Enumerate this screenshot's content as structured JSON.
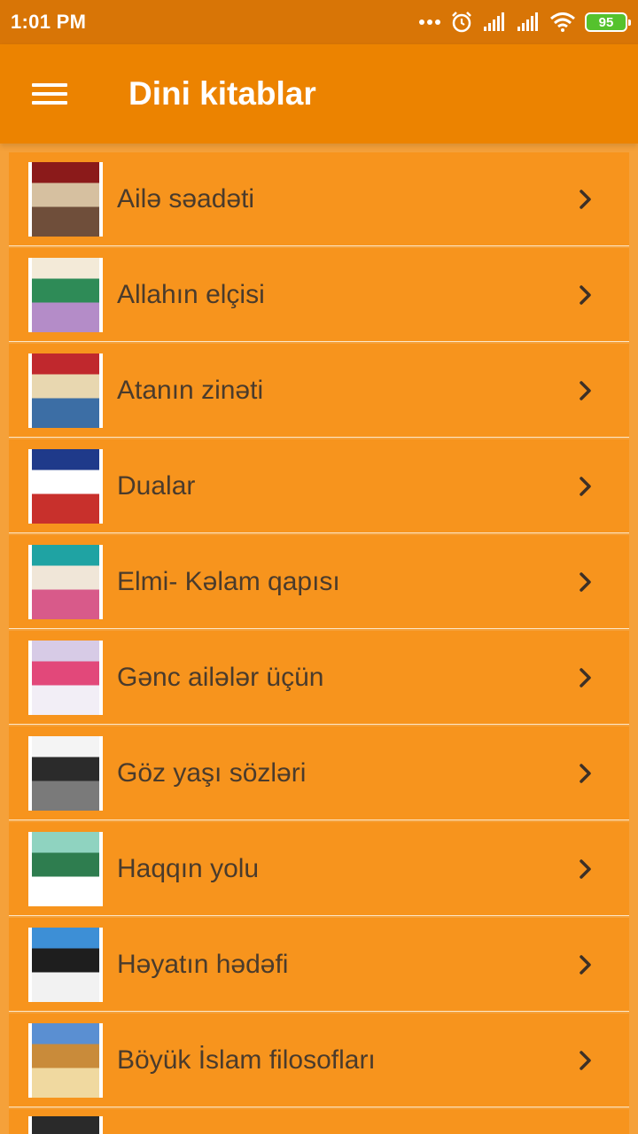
{
  "status_bar": {
    "time": "1:01 PM",
    "battery": "95"
  },
  "app_bar": {
    "title": "Dini kitablar",
    "menu_icon": "hamburger-menu-icon"
  },
  "books": [
    {
      "title": "Ailə səadəti",
      "cover_colors": [
        "#8b1a1a",
        "#d6c0a0",
        "#6f4e3a"
      ]
    },
    {
      "title": "Allahın elçisi",
      "cover_colors": [
        "#f3ead8",
        "#2e8b57",
        "#b48cc8"
      ]
    },
    {
      "title": "Atanın zinəti",
      "cover_colors": [
        "#c0282d",
        "#e8d7b0",
        "#3c6ea5"
      ]
    },
    {
      "title": "Dualar",
      "cover_colors": [
        "#1f3a8a",
        "#ffffff",
        "#c8302c"
      ]
    },
    {
      "title": "Elmi- Kəlam qapısı",
      "cover_colors": [
        "#1fa3a3",
        "#f0e6d8",
        "#d85a8a"
      ]
    },
    {
      "title": "Gənc ailələr üçün",
      "cover_colors": [
        "#d7cbe6",
        "#e2487a",
        "#f2eef6"
      ]
    },
    {
      "title": "Göz yaşı sözləri",
      "cover_colors": [
        "#f4f4f4",
        "#2b2b2b",
        "#7a7a7a"
      ]
    },
    {
      "title": "Haqqın yolu",
      "cover_colors": [
        "#8fd3c0",
        "#2e7d4f",
        "#ffffff"
      ]
    },
    {
      "title": "Həyatın hədəfi",
      "cover_colors": [
        "#3d8fd6",
        "#1e1e1e",
        "#f2f2f2"
      ]
    },
    {
      "title": "Böyük İslam filosofları",
      "cover_colors": [
        "#5a8fd2",
        "#c98b3a",
        "#f0d9a0"
      ]
    },
    {
      "title": "",
      "cover_colors": [
        "#2a2a2a",
        "#8a1c1c",
        "#ffffff"
      ]
    }
  ]
}
